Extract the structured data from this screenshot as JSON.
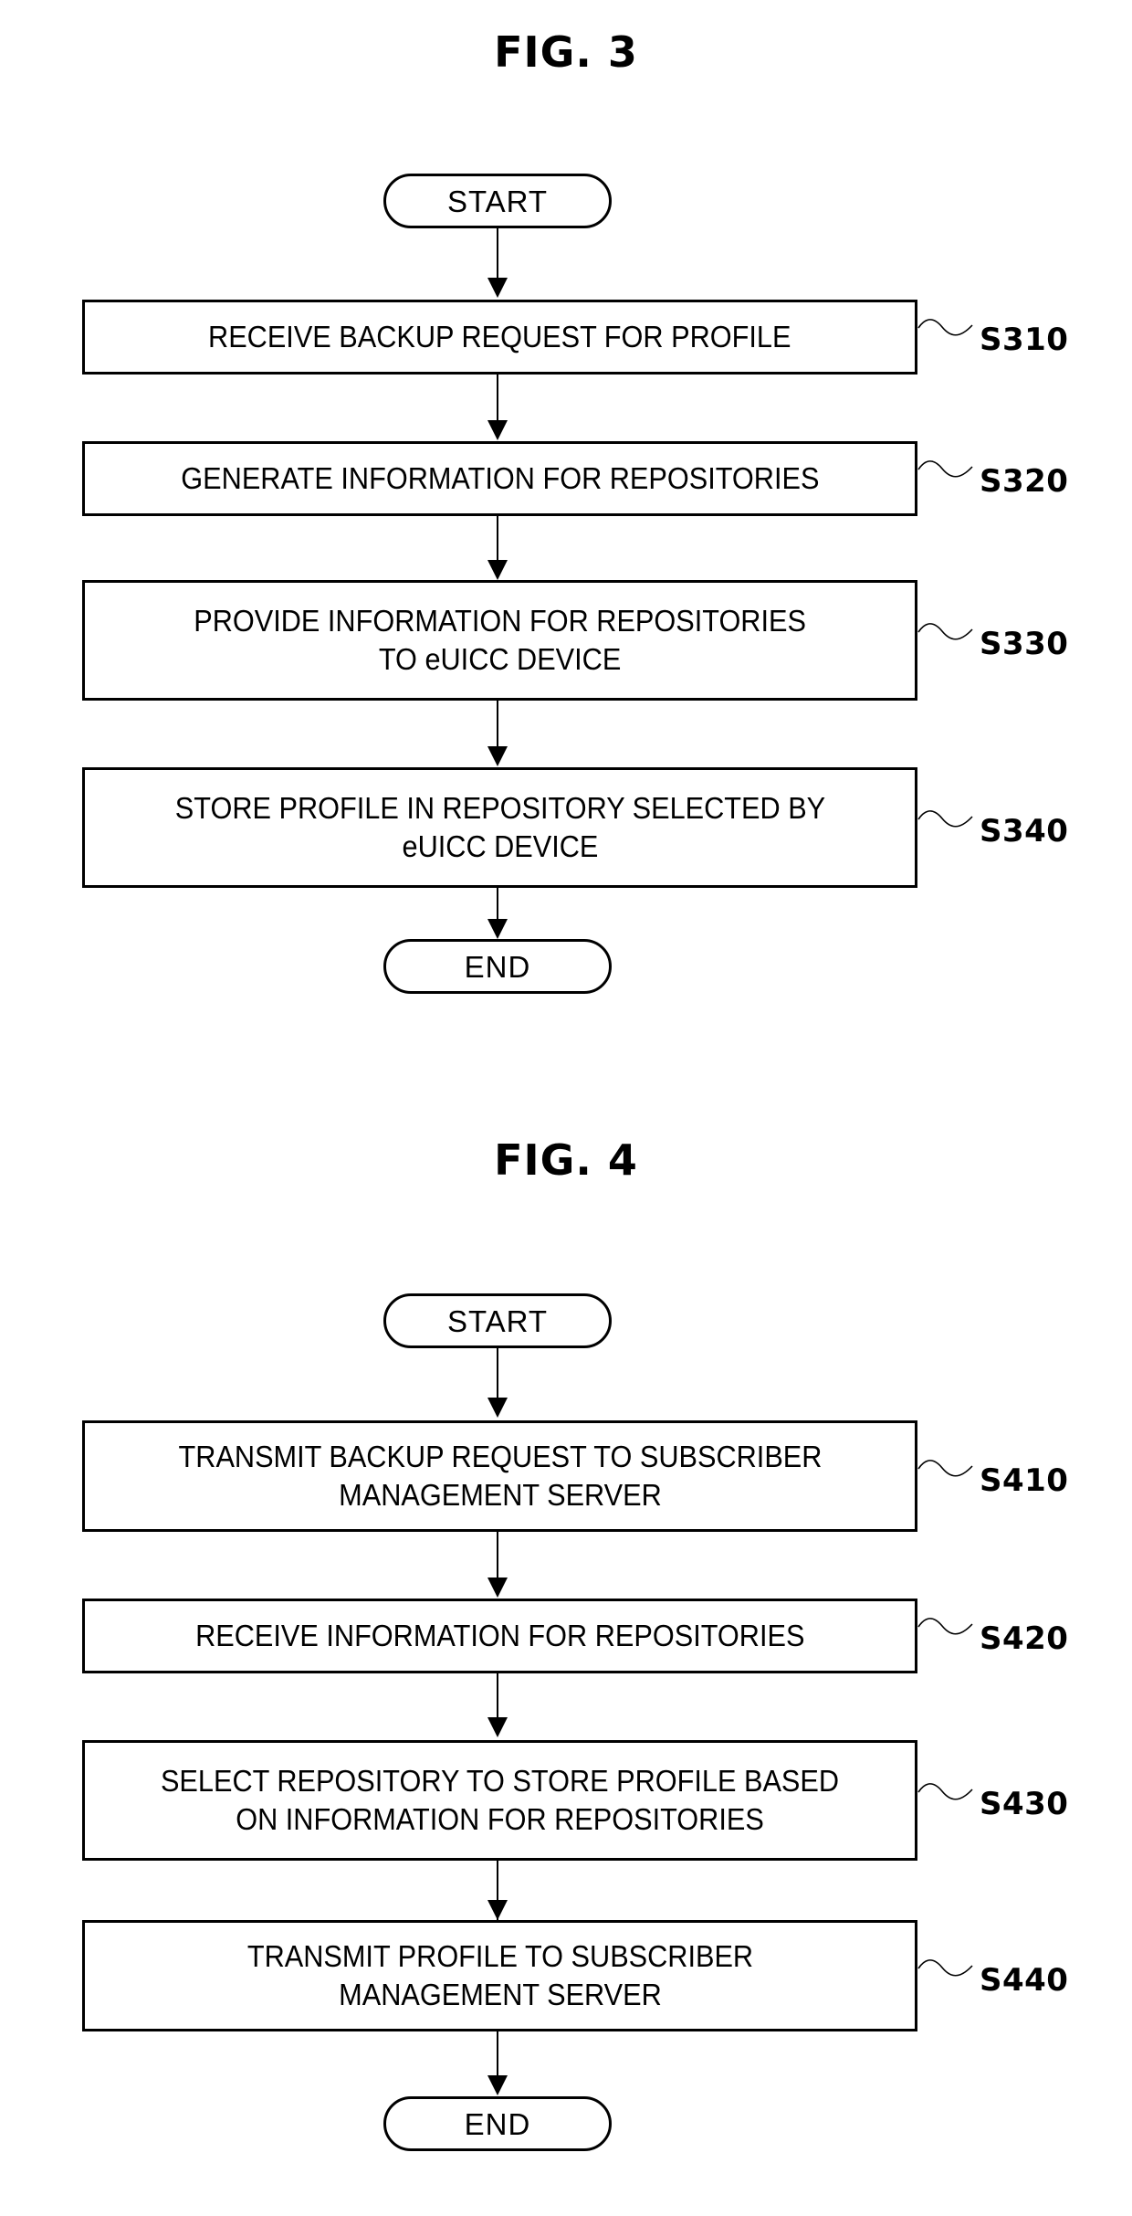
{
  "document": {
    "type": "patent-flowchart-sheet",
    "figures": [
      {
        "id": "fig3",
        "title": "FIG. 3",
        "start_label": "START",
        "end_label": "END",
        "steps": [
          {
            "text": "RECEIVE BACKUP REQUEST FOR PROFILE",
            "ref": "S310"
          },
          {
            "text": "GENERATE INFORMATION FOR REPOSITORIES",
            "ref": "S320"
          },
          {
            "text": "PROVIDE INFORMATION FOR REPOSITORIES\nTO eUICC DEVICE",
            "ref": "S330"
          },
          {
            "text": "STORE PROFILE IN REPOSITORY SELECTED BY\neUICC DEVICE",
            "ref": "S340"
          }
        ]
      },
      {
        "id": "fig4",
        "title": "FIG. 4",
        "start_label": "START",
        "end_label": "END",
        "steps": [
          {
            "text": "TRANSMIT BACKUP REQUEST TO SUBSCRIBER\nMANAGEMENT SERVER",
            "ref": "S410"
          },
          {
            "text": "RECEIVE INFORMATION FOR REPOSITORIES",
            "ref": "S420"
          },
          {
            "text": "SELECT REPOSITORY TO STORE PROFILE BASED\nON INFORMATION FOR REPOSITORIES",
            "ref": "S430"
          },
          {
            "text": "TRANSMIT PROFILE TO SUBSCRIBER\nMANAGEMENT SERVER",
            "ref": "S440"
          }
        ]
      }
    ],
    "colors": {
      "ink": "#000000",
      "paper": "#ffffff"
    }
  }
}
